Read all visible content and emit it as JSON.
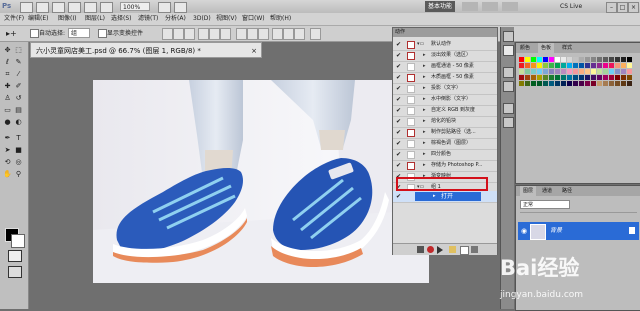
{
  "app": {
    "logo": "Ps",
    "zoom": "100%",
    "workspace": "基本功能",
    "cs_live": "CS Live",
    "window_controls": [
      "–",
      "□",
      "×"
    ]
  },
  "menu": {
    "items": [
      "文件(F)",
      "编辑(E)",
      "图像(I)",
      "图层(L)",
      "选择(S)",
      "滤镜(T)",
      "分析(A)",
      "3D(D)",
      "视图(V)",
      "窗口(W)",
      "帮助(H)"
    ]
  },
  "options": {
    "auto_select_label": "自动选择:",
    "auto_select_value": "组",
    "show_transform_label": "显示变换控件"
  },
  "document": {
    "tab_title": "六小灵童网店美工.psd @ 66.7% (图层 1, RGB/8) *",
    "close": "×"
  },
  "actions_panel": {
    "tab": "动作",
    "rows": [
      {
        "label": "默认动作",
        "checked": true,
        "dialog": true,
        "folder": true
      },
      {
        "label": "淡出效果（选区）",
        "checked": true,
        "dialog": true
      },
      {
        "label": "画框通道 - 50 像素",
        "checked": true,
        "dialog": false
      },
      {
        "label": "木质画框 - 50 像素",
        "checked": true,
        "dialog": true
      },
      {
        "label": "投影（文字）",
        "checked": true,
        "dialog": false
      },
      {
        "label": "水中倒影（文字）",
        "checked": true,
        "dialog": false
      },
      {
        "label": "自定义 RGB 到灰度",
        "checked": true,
        "dialog": false
      },
      {
        "label": "熔化的铅块",
        "checked": true,
        "dialog": false
      },
      {
        "label": "制作剪贴路径（选...",
        "checked": true,
        "dialog": true
      },
      {
        "label": "棕褐色调（图层）",
        "checked": true,
        "dialog": false
      },
      {
        "label": "四分颜色",
        "checked": true,
        "dialog": false
      },
      {
        "label": "存储为 Photoshop P...",
        "checked": true,
        "dialog": true
      },
      {
        "label": "渐变映射",
        "checked": true,
        "dialog": false
      },
      {
        "label": "组 1",
        "checked": true,
        "dialog": false,
        "folder": true
      }
    ],
    "selected_row": "打开"
  },
  "swatches_panel": {
    "tabs": [
      "颜色",
      "色板",
      "样式"
    ]
  },
  "layers_panel": {
    "tabs": [
      "图层",
      "通道",
      "路径"
    ],
    "blend_mode": "正常",
    "layer_name": "背景"
  },
  "watermark": {
    "brand": "Bai经验",
    "url": "jingyan.baidu.com"
  },
  "colors": {
    "accent": "#2a6bd6",
    "highlight_box": "#d3101a",
    "foreground": "#000000",
    "background": "#ffffff"
  }
}
